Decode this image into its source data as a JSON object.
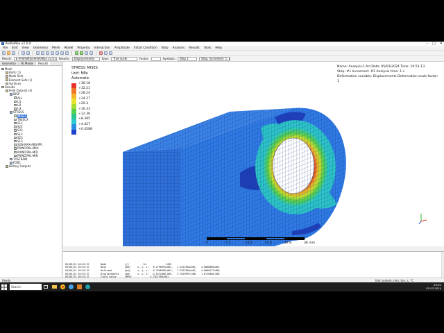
{
  "window": {
    "title": "PrePoMax v2.0.0",
    "minimize": "–",
    "maximize": "□",
    "close": "✕"
  },
  "menu": [
    "File",
    "Edit",
    "View",
    "Geometry",
    "Mesh",
    "Model",
    "Property",
    "Interaction",
    "Amplitude",
    "Initial Condition",
    "Step",
    "Analysis",
    "Results",
    "Tools",
    "Help"
  ],
  "resultbar": {
    "result_label": "Result:",
    "result_path": "E:\\PrePoMax\\PrePoMax v2.0.0\\Temp\\Analysis-1.frd",
    "type_label": "Type:",
    "type_value": "True scale",
    "factor_label": "Factor:",
    "symbols_label": "Symbols:",
    "symbols_value": "Step 1",
    "results_label": "Results:",
    "results_value": "Displacements",
    "step_value": "Step, Increment: 1, 1"
  },
  "sidebar": {
    "tabs": [
      "Geometry",
      "FE Model",
      "Results"
    ],
    "tree": [
      {
        "label": "Mesh",
        "level": 0
      },
      {
        "label": "Parts (1)",
        "level": 1
      },
      {
        "label": "Node Sets",
        "level": 1
      },
      {
        "label": "Element Sets (1)",
        "level": 1
      },
      {
        "label": "Surfaces",
        "level": 1
      },
      {
        "label": "Results",
        "level": 0
      },
      {
        "label": "Field Outputs (4)",
        "level": 1
      },
      {
        "label": "DISP",
        "level": 2
      },
      {
        "label": "ALL",
        "level": 3
      },
      {
        "label": "U1",
        "level": 3
      },
      {
        "label": "U2",
        "level": 3
      },
      {
        "label": "U3",
        "level": 3
      },
      {
        "label": "STRESS",
        "level": 2
      },
      {
        "label": "MISES",
        "level": 3,
        "selected": true
      },
      {
        "label": "TRESCA",
        "level": 3
      },
      {
        "label": "S11",
        "level": 3
      },
      {
        "label": "S22",
        "level": 3
      },
      {
        "label": "S33",
        "level": 3
      },
      {
        "label": "S12",
        "level": 3
      },
      {
        "label": "S23",
        "level": 3
      },
      {
        "label": "S13",
        "level": 3
      },
      {
        "label": "SGN-MAX-ABS-PRI",
        "level": 3
      },
      {
        "label": "PRINCIPAL-MAX",
        "level": 3
      },
      {
        "label": "PRINCIPAL-MID",
        "level": 3
      },
      {
        "label": "PRINCIPAL-MIN",
        "level": 3
      },
      {
        "label": "TOSTRAIN",
        "level": 2
      },
      {
        "label": "FORC",
        "level": 2
      },
      {
        "label": "History Outputs",
        "level": 1
      }
    ]
  },
  "legend": {
    "title": "STRESS: MISES",
    "unit": "Unit: MPa",
    "mode": "Automatic",
    "entries": [
      {
        "value": "+36.18",
        "color": "#e8322b"
      },
      {
        "value": "+32.21",
        "color": "#f0752a"
      },
      {
        "value": "+28.24",
        "color": "#f5b52a"
      },
      {
        "value": "+24.27",
        "color": "#e6e22d"
      },
      {
        "value": "+20.3",
        "color": "#a6dc30"
      },
      {
        "value": "+16.33",
        "color": "#52d24a"
      },
      {
        "value": "+12.36",
        "color": "#2bc78f"
      },
      {
        "value": "+8.395",
        "color": "#2bc9d2"
      },
      {
        "value": "+4.427",
        "color": "#2b8de0"
      },
      {
        "value": "+0.4588",
        "color": "#1f3fd0"
      }
    ]
  },
  "info": {
    "line1": "Name: Analysis-1.frd   Date: 05/03/2024   Time: 19:51:13",
    "line2": "Step: #1   Increment: #1   Analysis time: 1 s",
    "line3": "Deformation variable: Displacements   Deformation scale factor: 1"
  },
  "scale": {
    "labels": [
      "0",
      "7.2",
      "14.4",
      "21.6",
      "28.8",
      "36 mm"
    ]
  },
  "output_lines": [
    "03/05/24 20:52:37        Node             [/]          Id              3435",
    "03/05/24 20:52:37        Base             [mm]     x, y, z:   6.2790995+001,   1.3222368+001,   4.0000000+001",
    "03/05/24 20:52:37        Deformed         [mm]     x, y, z:   6.7958998+001,   1.3222368+001,   4.0000177+000",
    "03/05/24 20:52:37        Displacements    [mm]     x, y, z:  -4.9372088-005,   5.7819999-006,   1.6710560-006",
    "03/05/24 20:52:37        Field value      [MPa]             4.7871598+001"
  ],
  "status": {
    "left": "Ready",
    "right": "Unit system: mm, ton, s, °C"
  },
  "taskbar": {
    "search": "Search",
    "time": "20:02",
    "date": "05.03.2024"
  }
}
